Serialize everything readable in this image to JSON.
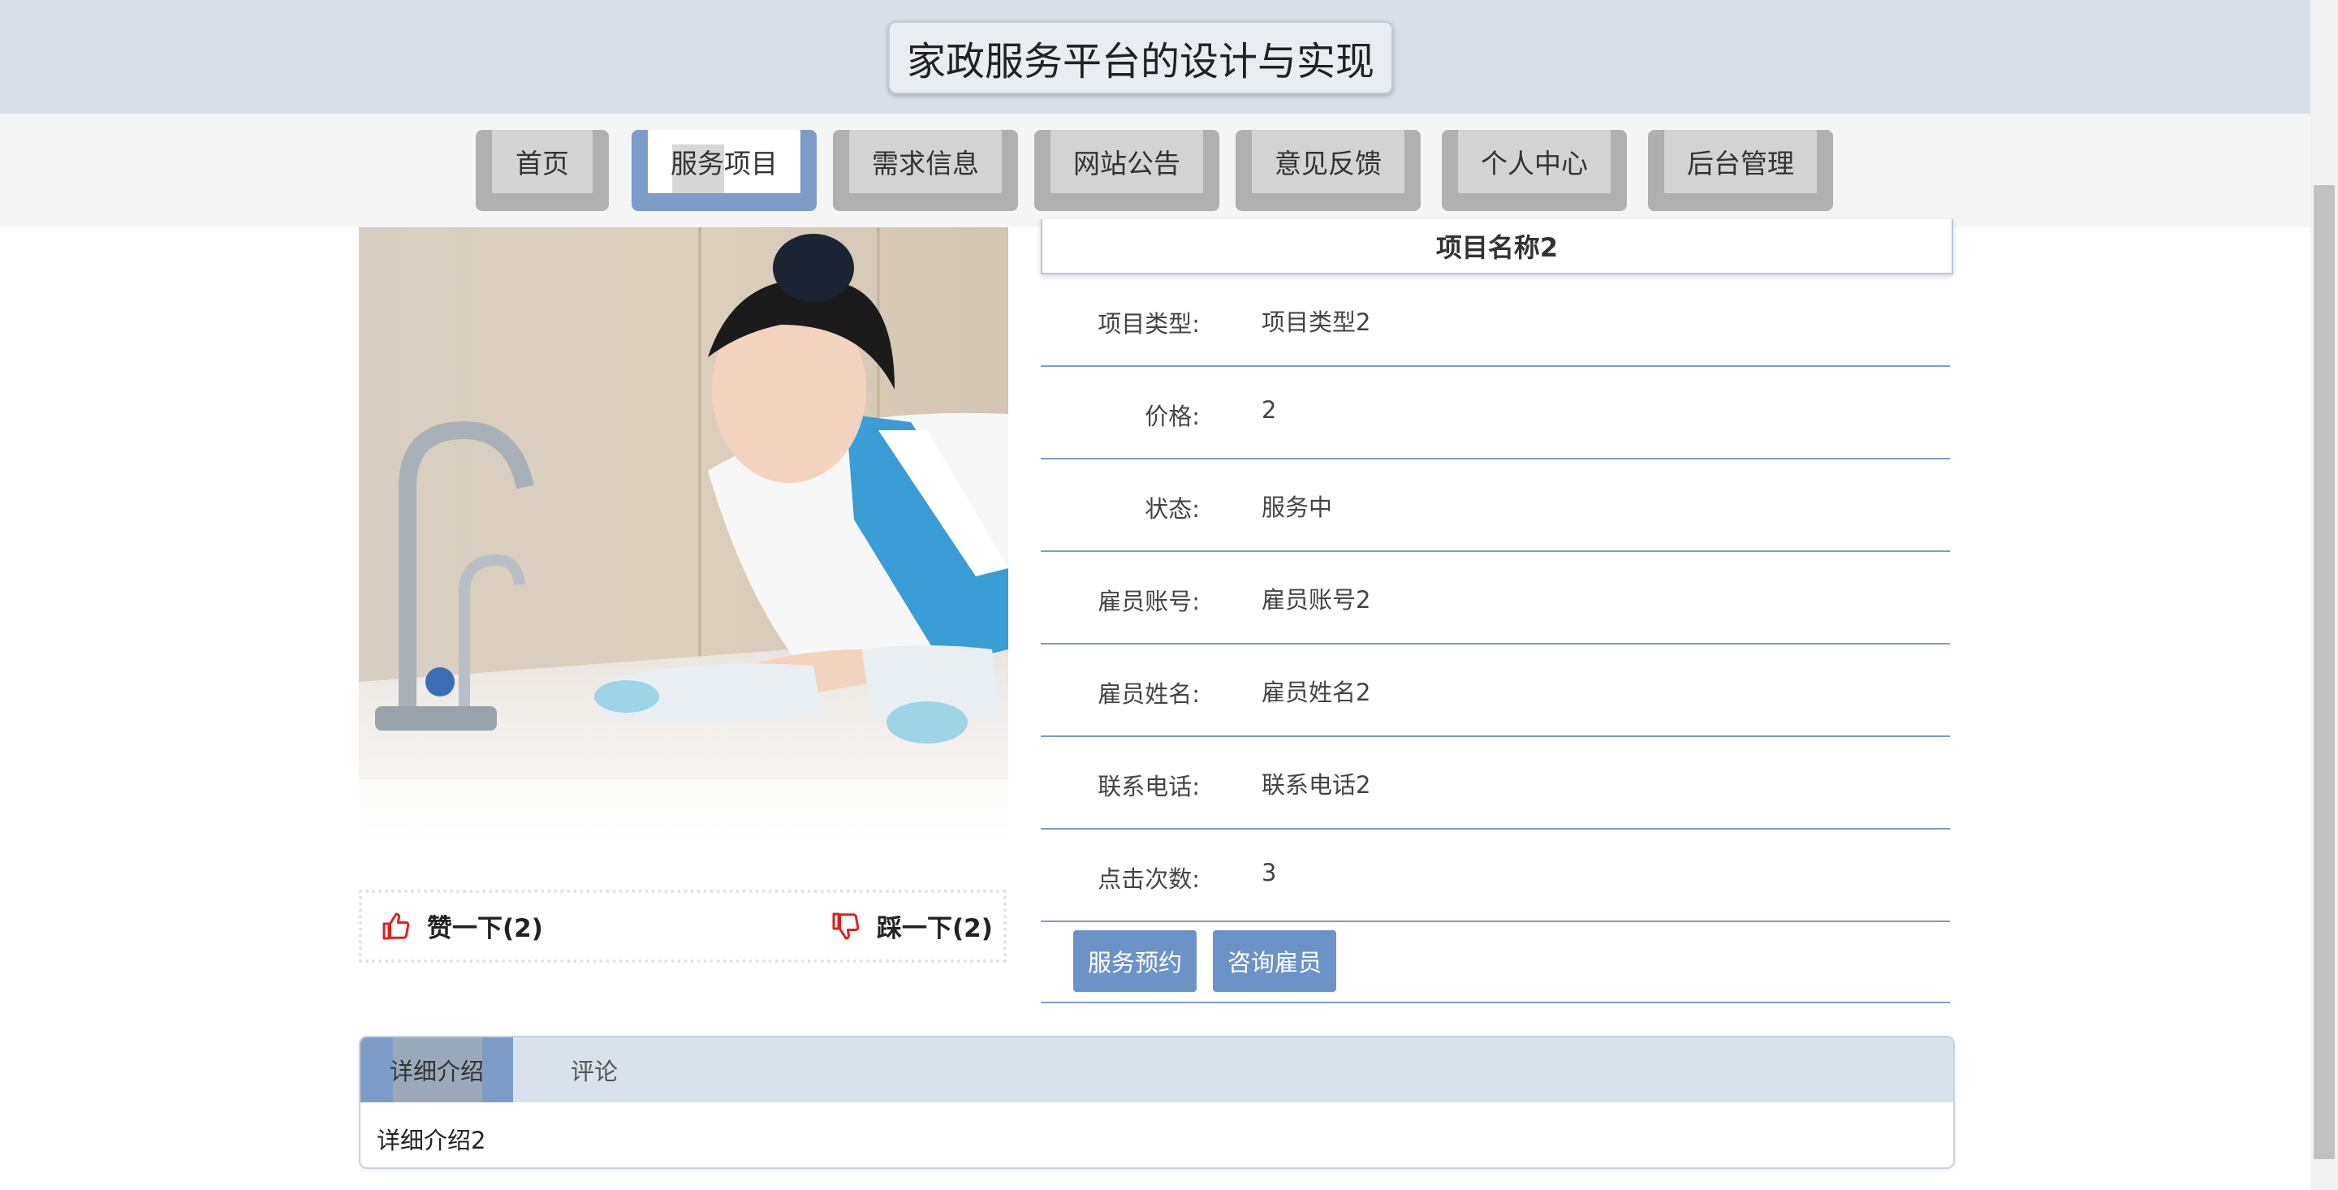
{
  "header": {
    "title": "家政服务平台的设计与实现"
  },
  "nav": {
    "items": [
      {
        "label": "首页"
      },
      {
        "label": "服务项目"
      },
      {
        "label": "需求信息"
      },
      {
        "label": "网站公告"
      },
      {
        "label": "意见反馈"
      },
      {
        "label": "个人中心"
      },
      {
        "label": "后台管理"
      }
    ],
    "active_index": 1
  },
  "votes": {
    "like_label": "赞一下(2)",
    "dislike_label": "踩一下(2)"
  },
  "detail": {
    "name": "项目名称2",
    "fields": [
      {
        "label": "项目类型:",
        "value": "项目类型2"
      },
      {
        "label": "价格:",
        "value": "2"
      },
      {
        "label": "状态:",
        "value": "服务中"
      },
      {
        "label": "雇员账号:",
        "value": "雇员账号2"
      },
      {
        "label": "雇员姓名:",
        "value": "雇员姓名2"
      },
      {
        "label": "联系电话:",
        "value": "联系电话2"
      },
      {
        "label": "点击次数:",
        "value": "3"
      }
    ],
    "buttons": {
      "book": "服务预约",
      "consult": "咨询雇员"
    }
  },
  "tabs": {
    "items": [
      {
        "label": "详细介绍"
      },
      {
        "label": "评论"
      }
    ],
    "active_index": 0,
    "content": "详细介绍2"
  },
  "colors": {
    "accent": "#7d9cc7",
    "button": "#6c93c6",
    "header_bg": "#d8dfe8",
    "icon_red": "#e02020"
  }
}
